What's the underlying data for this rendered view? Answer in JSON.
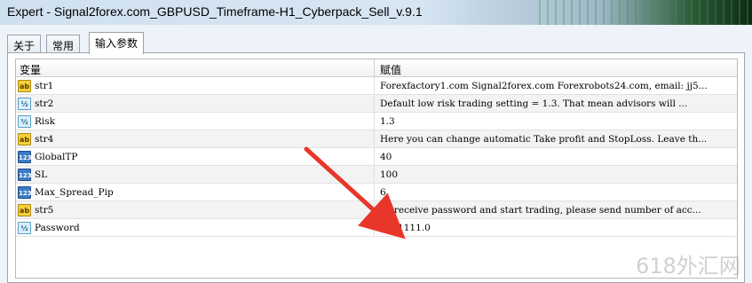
{
  "window": {
    "title": "Expert - Signal2forex.com_GBPUSD_Timeframe-H1_Cyberpack_Sell_v.9.1"
  },
  "tabs": [
    {
      "label": "关于",
      "active": false
    },
    {
      "label": "常用",
      "active": false
    },
    {
      "label": "输入参数",
      "active": true
    }
  ],
  "grid": {
    "columns": {
      "name": "变量",
      "value": "赋值"
    },
    "rows": [
      {
        "icon": "ab",
        "name": "str1",
        "value": "Forexfactory1.com Signal2forex.com Forexrobots24.com, email: jj5..."
      },
      {
        "icon": "dbl",
        "name": "str2",
        "value": "Default low risk trading setting = 1.3. That mean advisors will ..."
      },
      {
        "icon": "dbl",
        "name": "Risk",
        "value": "1.3"
      },
      {
        "icon": "ab",
        "name": "str4",
        "value": "Here you can change automatic Take profit and StopLoss. Leave th..."
      },
      {
        "icon": "num",
        "name": "GlobalTP",
        "value": "40"
      },
      {
        "icon": "num",
        "name": "SL",
        "value": "100"
      },
      {
        "icon": "num",
        "name": "Max_Spread_Pip",
        "value": "6"
      },
      {
        "icon": "ab",
        "name": "str5",
        "value": "To receive password and start trading, please send number of acc..."
      },
      {
        "icon": "dbl",
        "name": "Password",
        "value": "1111111.0"
      }
    ]
  },
  "icons": {
    "ab": "ab",
    "num": "123",
    "dbl": "½"
  },
  "annotation": {
    "color": "#e8362b"
  },
  "watermark": "618外汇网"
}
